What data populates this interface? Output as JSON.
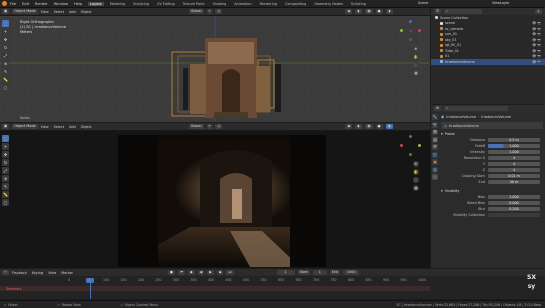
{
  "topbar": {
    "menus": [
      "File",
      "Edit",
      "Render",
      "Window",
      "Help"
    ],
    "workspaces": [
      "Layout",
      "Modeling",
      "Sculpting",
      "UV Editing",
      "Texture Paint",
      "Shading",
      "Animation",
      "Rendering",
      "Compositing",
      "Geometry Nodes",
      "Scripting"
    ],
    "active_workspace": "Layout",
    "scene_label": "Scene",
    "viewlayer_label": "ViewLayer"
  },
  "viewport_top": {
    "mode": "Object Mode",
    "menus": [
      "View",
      "Select",
      "Add",
      "Object"
    ],
    "orientation": "Global",
    "overlay_line1": "Right Orthographic",
    "overlay_line2": "(1) SC | IrradianceVolume",
    "overlay_line3": "Meters",
    "bottom_label": "Notes"
  },
  "viewport_bottom": {
    "mode": "Object Mode",
    "menus": [
      "View",
      "Select",
      "Add",
      "Object"
    ],
    "orientation": "Global"
  },
  "outliner": {
    "title": "Scene Collection",
    "items": [
      {
        "label": "scene",
        "color": "#e0e0e0",
        "selected": false
      },
      {
        "label": "sc_camera",
        "color": "#d08a3a",
        "selected": false
      },
      {
        "label": "sun_01",
        "color": "#d08a3a",
        "selected": false
      },
      {
        "label": "sky_01",
        "color": "#d08a3a",
        "selected": false
      },
      {
        "label": "lgt_fill_01",
        "color": "#d08a3a",
        "selected": false
      },
      {
        "label": "Tube_01",
        "color": "#d08a3a",
        "selected": false
      },
      {
        "label": "01",
        "color": "#d08a3a",
        "selected": false
      },
      {
        "label": "IrradianceVolume",
        "color": "#87b7e8",
        "selected": true
      }
    ]
  },
  "properties": {
    "breadcrumb_obj": "IrradianceVolume",
    "breadcrumb_data": "IrradianceVolume",
    "datablock_name": "IrradianceVolume",
    "panel_probe": "Probe",
    "fields": [
      {
        "label": "Distance",
        "value": "0.5 m",
        "blue": false
      },
      {
        "label": "Falloff",
        "value": "1.000",
        "blue": true
      },
      {
        "label": "Intensity",
        "value": "1.000",
        "blue": false
      },
      {
        "label": "Resolution X",
        "value": "4",
        "blue": false
      },
      {
        "label": "Y",
        "value": "4",
        "blue": false
      },
      {
        "label": "Z",
        "value": "4",
        "blue": false
      },
      {
        "label": "Clipping Start",
        "value": "0.01 m",
        "blue": false
      },
      {
        "label": "End",
        "value": "40 m",
        "blue": false
      }
    ],
    "panel_visibility": "Visibility",
    "vis_fields": [
      {
        "label": "Bias",
        "value": "1.000"
      },
      {
        "label": "Bleed Bias",
        "value": "0.000"
      },
      {
        "label": "Blur",
        "value": "0.200"
      }
    ],
    "collection_label": "Visibility Collection"
  },
  "timeline": {
    "menus": [
      "Playback",
      "Keying",
      "View",
      "Marker"
    ],
    "current_frame": "1",
    "start_label": "Start",
    "start_value": "1",
    "end_label": "End",
    "end_value": "1000",
    "ticks": [
      "0",
      "50",
      "100",
      "150",
      "200",
      "250",
      "300",
      "350",
      "400",
      "450",
      "500",
      "550",
      "600",
      "650",
      "700",
      "750",
      "800",
      "850",
      "900",
      "950",
      "1000"
    ],
    "summary_label": "Summary",
    "playhead_frame": "1"
  },
  "statusbar": {
    "left": "Select",
    "middle1": "Rotate View",
    "middle2": "Object Context Menu",
    "right": "SC | IrradianceVolume | Verts:32,663 | Faces:27,268 | Tris:55,246 | Objects:1/8 | 3.0.0 Beta"
  },
  "watermark": {
    "line1": "SX",
    "line2": "sy"
  },
  "colors": {
    "accent": "#4772b3",
    "bg": "#1d1d1d",
    "header": "#2b2b2b"
  }
}
